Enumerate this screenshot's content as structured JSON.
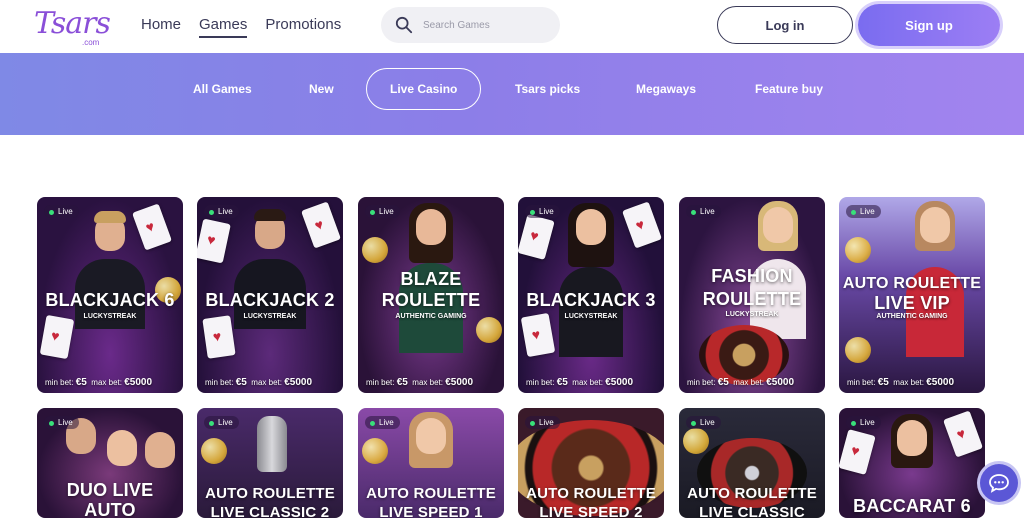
{
  "header": {
    "logo_text": "Tsars",
    "logo_sub": ".com",
    "nav": [
      "Home",
      "Games",
      "Promotions"
    ],
    "active_nav": "Games",
    "search_placeholder": "Search Games",
    "login_label": "Log in",
    "signup_label": "Sign up"
  },
  "categories": {
    "tabs": [
      "All Games",
      "New",
      "Live Casino",
      "Tsars picks",
      "Megaways",
      "Feature buy"
    ],
    "active": "Live Casino"
  },
  "icons": {
    "search": "search-icon",
    "chat": "chat-icon"
  },
  "colors": {
    "brand": "#8a4fd8",
    "band_start": "#7f89e6",
    "band_end": "#a284ef",
    "signup": "#7a6cf0",
    "live_dot": "#39e07a",
    "chat": "#5b57d6"
  },
  "games": {
    "live_label": "Live",
    "row1": [
      {
        "title_1": "BLACKJACK 6",
        "title_2": "",
        "provider": "LUCKYSTREAK",
        "min_label": "min bet:",
        "min": "€5",
        "max_label": "max bet:",
        "max": "€5000"
      },
      {
        "title_1": "BLACKJACK 2",
        "title_2": "",
        "provider": "LUCKYSTREAK",
        "min_label": "min bet:",
        "min": "€5",
        "max_label": "max bet:",
        "max": "€5000"
      },
      {
        "title_1": "BLAZE",
        "title_2": "ROULETTE",
        "provider": "AUTHENTIC GAMING",
        "min_label": "min bet:",
        "min": "€5",
        "max_label": "max bet:",
        "max": "€5000"
      },
      {
        "title_1": "BLACKJACK 3",
        "title_2": "",
        "provider": "LUCKYSTREAK",
        "min_label": "min bet:",
        "min": "€5",
        "max_label": "max bet:",
        "max": "€5000"
      },
      {
        "title_1": "FASHION",
        "title_2": "ROULETTE",
        "provider": "LUCKYSTREAK",
        "min_label": "min bet:",
        "min": "€5",
        "max_label": "max bet:",
        "max": "€5000"
      },
      {
        "title_1": "AUTO ROULETTE",
        "title_2": "LIVE VIP",
        "provider": "AUTHENTIC GAMING",
        "min_label": "min bet:",
        "min": "€5",
        "max_label": "max bet:",
        "max": "€5000"
      }
    ],
    "row2": [
      {
        "title_1": "DUO LIVE",
        "title_2": "AUTO"
      },
      {
        "title_1": "AUTO ROULETTE",
        "title_2": "LIVE CLASSIC 2"
      },
      {
        "title_1": "AUTO ROULETTE",
        "title_2": "LIVE SPEED 1"
      },
      {
        "title_1": "AUTO ROULETTE",
        "title_2": "LIVE SPEED 2"
      },
      {
        "title_1": "AUTO ROULETTE",
        "title_2": "LIVE CLASSIC"
      },
      {
        "title_1": "BACCARAT 6",
        "title_2": ""
      }
    ]
  }
}
